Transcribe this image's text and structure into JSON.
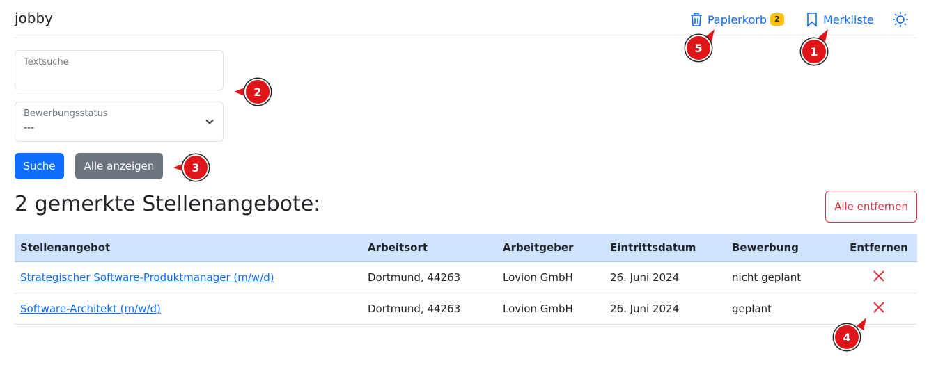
{
  "navbar": {
    "brand": "jobby",
    "trash": {
      "label": "Papierkorb",
      "count": "2",
      "icon": "trash-icon"
    },
    "bookmarks": {
      "label": "Merkliste",
      "icon": "bookmark-icon"
    },
    "theme": {
      "icon": "sun-icon"
    }
  },
  "search": {
    "text_label": "Textsuche",
    "text_value": "",
    "status_label": "Bewerbungsstatus",
    "status_value": "---",
    "search_button": "Suche",
    "show_all_button": "Alle anzeigen"
  },
  "main": {
    "heading": "2 gemerkte Stellenangebote:",
    "remove_all_button": "Alle entfernen"
  },
  "table": {
    "headers": [
      "Stellenangebot",
      "Arbeitsort",
      "Arbeitgeber",
      "Eintrittsdatum",
      "Bewerbung",
      "Entfernen"
    ],
    "rows": [
      {
        "title": "Strategischer Software-Produktmanager (m/w/d)",
        "location": "Dortmund, 44263",
        "employer": "Lovion GmbH",
        "start": "26. Juni 2024",
        "application": "nicht geplant"
      },
      {
        "title": "Software-Architekt (m/w/d)",
        "location": "Dortmund, 44263",
        "employer": "Lovion GmbH",
        "start": "26. Juni 2024",
        "application": "geplant"
      }
    ]
  },
  "annotations": [
    "1",
    "2",
    "3",
    "4",
    "5"
  ],
  "colors": {
    "primary": "#0d6efd",
    "secondary": "#6c757d",
    "danger": "#dc3545",
    "badge": "#ffc107",
    "table_header": "#cfe2ff",
    "marker": "#e0151a"
  }
}
